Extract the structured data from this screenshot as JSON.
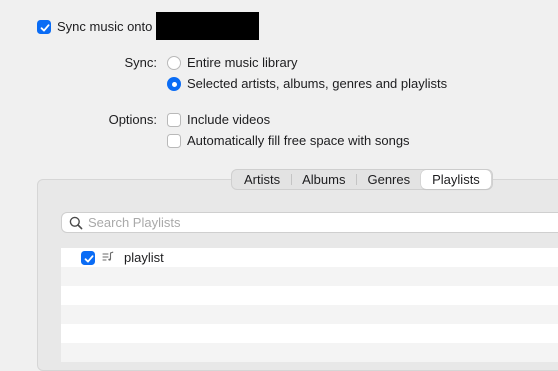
{
  "sync_music": {
    "label": "Sync music onto",
    "checked": true
  },
  "sync": {
    "label": "Sync:",
    "options": [
      {
        "label": "Entire music library",
        "selected": false
      },
      {
        "label": "Selected artists, albums, genres and playlists",
        "selected": true
      }
    ]
  },
  "options": {
    "label": "Options:",
    "items": [
      {
        "label": "Include videos",
        "checked": false
      },
      {
        "label": "Automatically fill free space with songs",
        "checked": false
      }
    ]
  },
  "tabs": [
    {
      "label": "Artists",
      "active": false
    },
    {
      "label": "Albums",
      "active": false
    },
    {
      "label": "Genres",
      "active": false
    },
    {
      "label": "Playlists",
      "active": true
    }
  ],
  "search": {
    "placeholder": "Search Playlists",
    "icon": "magnifier-icon"
  },
  "playlists": [
    {
      "name": "playlist",
      "checked": true,
      "icon": "playlist-icon"
    }
  ],
  "colors": {
    "accent": "#0a6cf5",
    "background": "#f0f0f0"
  }
}
